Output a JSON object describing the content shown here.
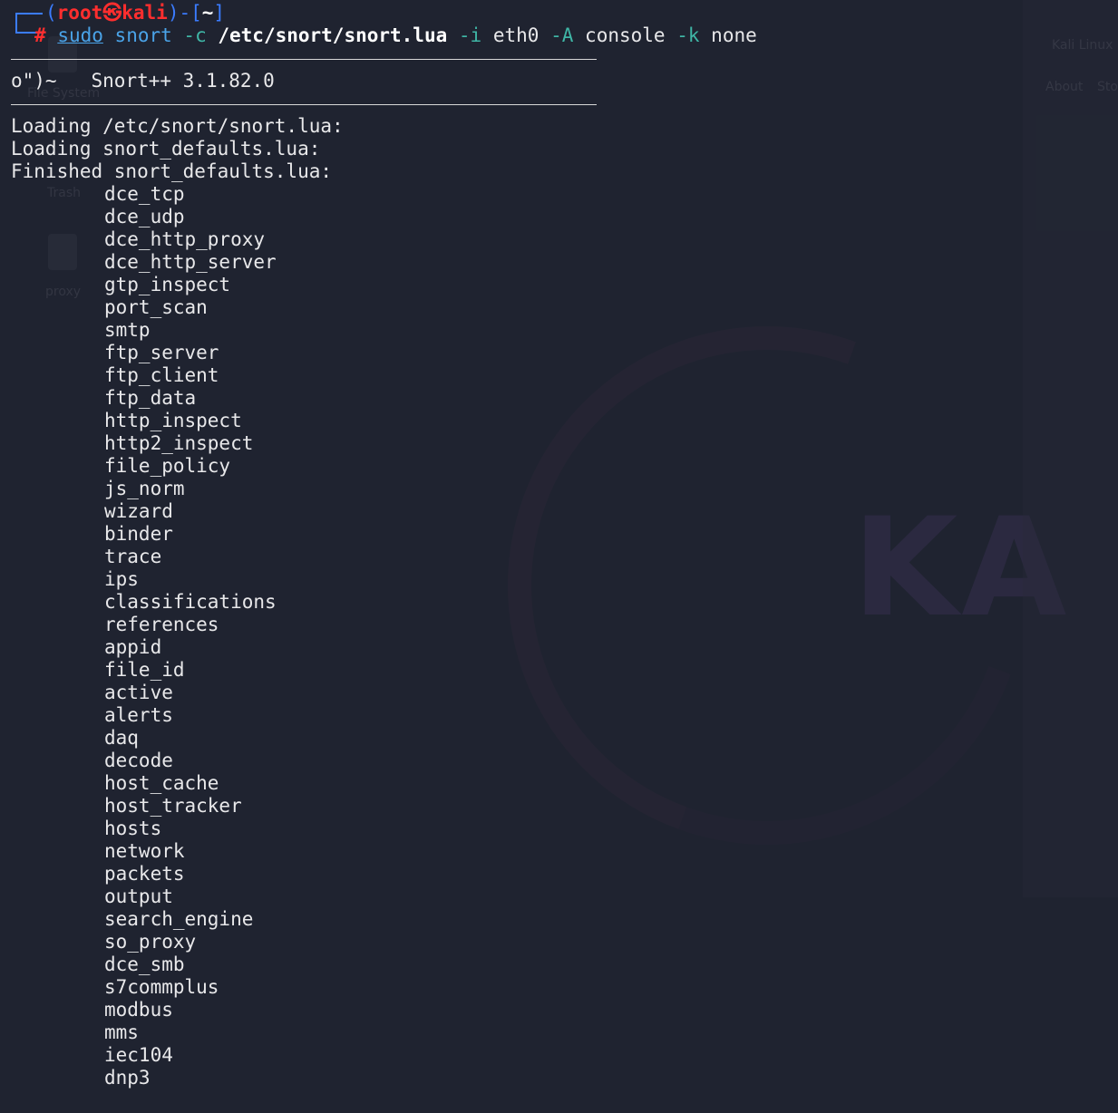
{
  "prompt": {
    "open_paren": "(",
    "user": "root",
    "at_symbol": "㉿",
    "host": "kali",
    "close_paren": ")-[",
    "cwd": "~",
    "close_bracket": "]",
    "hash": "#",
    "cmd_sudo": "sudo",
    "cmd_snort": "snort",
    "flag_c": "-c",
    "config_path": "/etc/snort/snort.lua",
    "flag_i": "-i",
    "iface": "eth0",
    "flag_A": "-A",
    "alert_mode": "console",
    "flag_k": "-k",
    "checksum_mode": "none"
  },
  "banner": {
    "logo": "o\")~",
    "version": "Snort++ 3.1.82.0"
  },
  "loading_lines": [
    "Loading /etc/snort/snort.lua:",
    "Loading snort_defaults.lua:",
    "Finished snort_defaults.lua:"
  ],
  "modules": [
    "dce_tcp",
    "dce_udp",
    "dce_http_proxy",
    "dce_http_server",
    "gtp_inspect",
    "port_scan",
    "smtp",
    "ftp_server",
    "ftp_client",
    "ftp_data",
    "http_inspect",
    "http2_inspect",
    "file_policy",
    "js_norm",
    "wizard",
    "binder",
    "trace",
    "ips",
    "classifications",
    "references",
    "appid",
    "file_id",
    "active",
    "alerts",
    "daq",
    "decode",
    "host_cache",
    "host_tracker",
    "hosts",
    "network",
    "packets",
    "output",
    "search_engine",
    "so_proxy",
    "dce_smb",
    "s7commplus",
    "modbus",
    "mms",
    "iec104",
    "dnp3"
  ],
  "desktop_background": {
    "watermark_text": "KA",
    "desktop_icons": [
      "File System",
      "Trash",
      "proxy"
    ],
    "panel_labels": [
      "Kali Linux",
      "About",
      "Sto"
    ]
  },
  "colors": {
    "background": "#1f2330",
    "prompt_frame": "#3b7cff",
    "prompt_user": "#ff2e2e",
    "command": "#4aa3e8",
    "flags": "#3fb6a6",
    "text": "#e8e8ea"
  }
}
